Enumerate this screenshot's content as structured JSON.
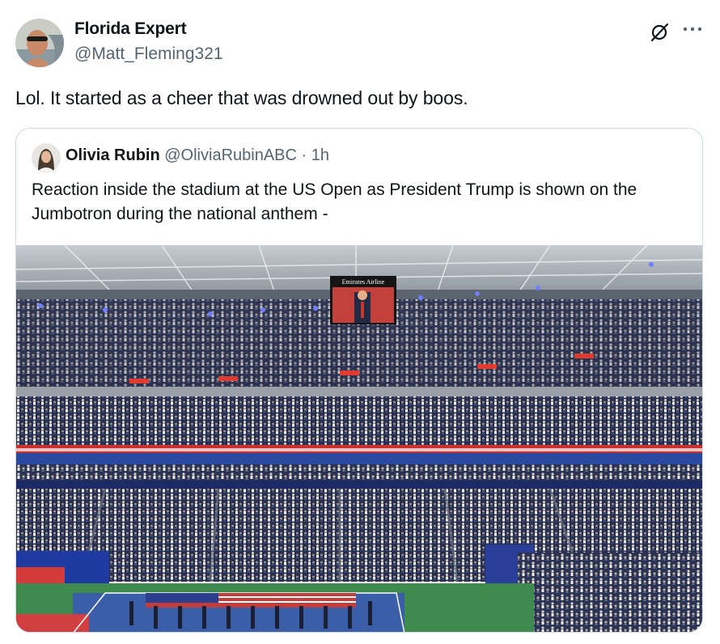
{
  "tweet": {
    "author_name": "Florida Expert",
    "author_handle": "@Matt_Fleming321",
    "text": "Lol. It started as a cheer that was drowned out by boos.",
    "more_icon": "more-horizontal-icon",
    "grok_icon": "grok-icon"
  },
  "quote": {
    "author_name": "Olivia Rubin",
    "author_handle": "@OliviaRubinABC",
    "separator": "·",
    "time": "1h",
    "text": "Reaction inside the stadium at the US Open as President Trump is shown on the Jumbotron during the national anthem -",
    "media": {
      "jumbotron_label": "Emirates Airline"
    }
  },
  "colors": {
    "text_primary": "#0f1419",
    "text_secondary": "#536471",
    "border": "#cfd9de",
    "court_blue": "#3a5fa8",
    "court_green": "#3f8a4e",
    "seat_navy": "#1f2d57"
  }
}
